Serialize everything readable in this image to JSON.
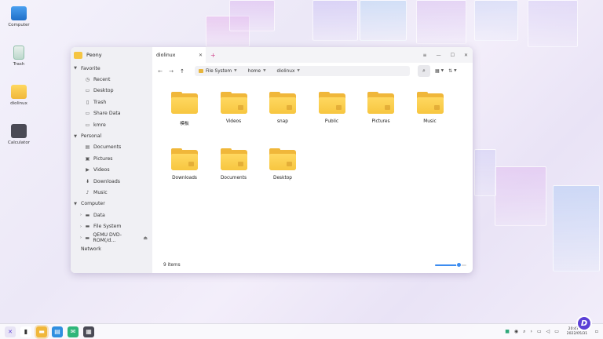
{
  "desktop": {
    "icons": [
      {
        "label": "Computer",
        "icon": "computer-icon",
        "color": "#2f7fd8"
      },
      {
        "label": "Trash",
        "icon": "trash-icon",
        "color": "#2fa87a"
      },
      {
        "label": "diolinux",
        "icon": "folder-icon",
        "color": "#f0b73a"
      },
      {
        "label": "Calculator",
        "icon": "calculator-icon",
        "color": "#4a4a55"
      }
    ]
  },
  "window": {
    "app_name": "Peony",
    "tab_title": "diolinux",
    "new_tab": "+",
    "controls": {
      "menu": "≡",
      "minimize": "—",
      "maximize": "☐",
      "close": "✕"
    },
    "sidebar": {
      "favorite": {
        "label": "Favorite",
        "items": [
          "Recent",
          "Desktop",
          "Trash",
          "Share Data",
          "kmre"
        ]
      },
      "personal": {
        "label": "Personal",
        "items": [
          "Documents",
          "Pictures",
          "Videos",
          "Downloads",
          "Music"
        ]
      },
      "computer": {
        "label": "Computer",
        "items": [
          "Data",
          "File System",
          "QEMU DVD-ROM(/d..."
        ]
      },
      "network": {
        "label": "Network"
      }
    },
    "toolbar": {
      "back": "←",
      "forward": "→",
      "up": "↑",
      "path": [
        "File System",
        "home",
        "diolinux"
      ]
    },
    "folders": [
      "模板",
      "Videos",
      "snap",
      "Public",
      "Pictures",
      "Music",
      "Downloads",
      "Documents",
      "Desktop"
    ],
    "status": {
      "items": "9 items",
      "zoom_level": 0.75
    }
  },
  "taskbar": {
    "apps": [
      {
        "name": "start-menu",
        "color": "#5b3fd6"
      },
      {
        "name": "multitask-view",
        "color": "#333333"
      },
      {
        "name": "file-manager",
        "color": "#f0b73a"
      },
      {
        "name": "software-store",
        "color": "#2f8fe0"
      },
      {
        "name": "mail",
        "color": "#2fb67a"
      },
      {
        "name": "calculator",
        "color": "#4a4a55"
      }
    ],
    "clock": {
      "time": "20:47 Tue",
      "date": "2022/05/31"
    }
  },
  "colors": {
    "accent": "#3c8cf0",
    "folder": "#f0b73a",
    "tab_plus": "#d0458c"
  }
}
